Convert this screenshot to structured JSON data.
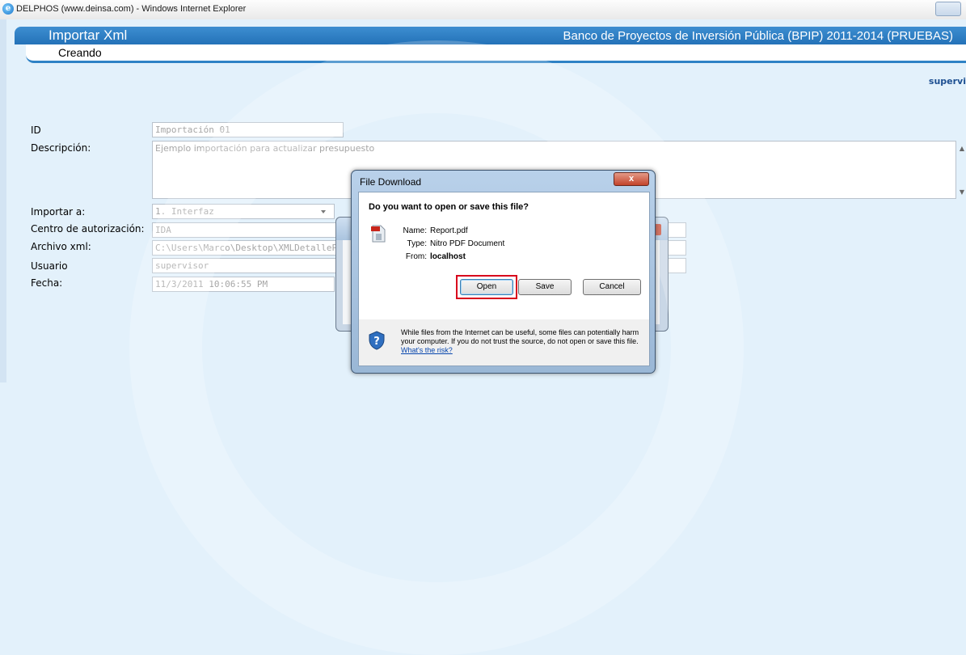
{
  "window": {
    "title": "DELPHOS (www.deinsa.com) - Windows Internet Explorer"
  },
  "header": {
    "app_title": "Importar Xml",
    "bank_title": "Banco de Proyectos de Inversión Pública (BPIP) 2011-2014 (PRUEBAS)",
    "mode": "Creando",
    "user_link": "supervi"
  },
  "form": {
    "id": {
      "label": "ID",
      "value": "Importación 01"
    },
    "descripcion": {
      "label": "Descripción:",
      "value": "Ejemplo importación para actualizar presupuesto"
    },
    "importar_a": {
      "label": "Importar a:",
      "value": "1. Interfaz"
    },
    "centro": {
      "label": "Centro de autorización:",
      "value": "IDA"
    },
    "archivo": {
      "label": "Archivo xml:",
      "value": "C:\\Users\\Marco\\Desktop\\XMLDetallePresupu"
    },
    "usuario": {
      "label": "Usuario",
      "value": "supervisor"
    },
    "fecha": {
      "label": "Fecha:",
      "value": "11/3/2011 10:06:55 PM"
    }
  },
  "dialog": {
    "title": "File Download",
    "close_glyph": "x",
    "question": "Do you want to open or save this file?",
    "name_key": "Name:",
    "name_val": "Report.pdf",
    "type_key": "Type:",
    "type_val": "Nitro PDF Document",
    "from_key": "From:",
    "from_val": "localhost",
    "open_label": "Open",
    "save_label": "Save",
    "cancel_label": "Cancel",
    "warning": "While files from the Internet can be useful, some files can potentially harm your computer. If you do not trust the source, do not open or save this file.",
    "risk_link": "What's the risk?"
  },
  "colors": {
    "header": "#2f82c5",
    "highlight": "#d8001c",
    "background": "#e3f1fb"
  },
  "icons": [
    "ie-icon",
    "pdf-file-icon",
    "shield-warning-icon",
    "close-icon",
    "dropdown-arrow-icon"
  ]
}
